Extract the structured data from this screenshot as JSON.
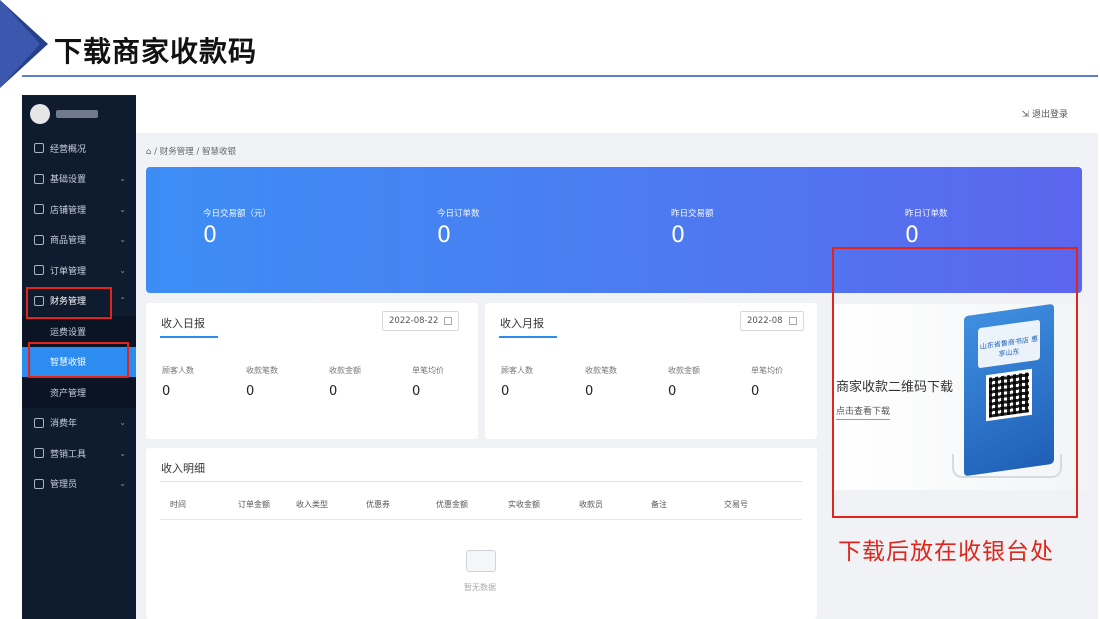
{
  "slide": {
    "title": "下载商家收款码"
  },
  "topbar": {
    "logout": "退出登录"
  },
  "breadcrumb": {
    "home_sep": "/",
    "level1": "财务管理",
    "sep": "/",
    "level2": "智慧收银"
  },
  "sidebar": {
    "items": [
      {
        "label": "经营概况",
        "chevron": ""
      },
      {
        "label": "基础设置",
        "chevron": "⌄"
      },
      {
        "label": "店铺管理",
        "chevron": "⌄"
      },
      {
        "label": "商品管理",
        "chevron": "⌄"
      },
      {
        "label": "订单管理",
        "chevron": "⌄"
      },
      {
        "label": "财务管理",
        "chevron": "⌃"
      }
    ],
    "subitems": [
      {
        "label": "运费设置"
      },
      {
        "label": "智慧收银"
      },
      {
        "label": "资产管理"
      }
    ],
    "items_after": [
      {
        "label": "消费年",
        "chevron": "⌄"
      },
      {
        "label": "营销工具",
        "chevron": "⌄"
      },
      {
        "label": "管理员",
        "chevron": "⌄"
      }
    ]
  },
  "banner": {
    "stats": [
      {
        "label": "今日交易额（元）",
        "value": "0"
      },
      {
        "label": "今日订单数",
        "value": "0"
      },
      {
        "label": "昨日交易额",
        "value": "0"
      },
      {
        "label": "昨日订单数",
        "value": "0"
      }
    ]
  },
  "daily": {
    "title": "收入日报",
    "date": "2022-08-22",
    "metrics": [
      {
        "label": "顾客人数",
        "value": "0"
      },
      {
        "label": "收款笔数",
        "value": "0"
      },
      {
        "label": "收款金额",
        "value": "0"
      },
      {
        "label": "单笔均价",
        "value": "0"
      }
    ]
  },
  "monthly": {
    "title": "收入月报",
    "date": "2022-08",
    "metrics": [
      {
        "label": "顾客人数",
        "value": "0"
      },
      {
        "label": "收款笔数",
        "value": "0"
      },
      {
        "label": "收款金额",
        "value": "0"
      },
      {
        "label": "单笔均价",
        "value": "0"
      }
    ]
  },
  "details": {
    "title": "收入明细",
    "columns": [
      "时间",
      "订单金额",
      "收入类型",
      "优惠券",
      "优惠金额",
      "实收金额",
      "收款员",
      "备注",
      "交易号"
    ],
    "empty": "暂无数据"
  },
  "promo": {
    "title": "商家收款二维码下载",
    "link": "点击查看下载",
    "stand_text": "山东省鲁商书店 惠享山东"
  },
  "caption": "下载后放在收银台处",
  "colors": {
    "accent": "#2d8cf0",
    "sidebar_bg": "#0f1c30",
    "highlight": "#e1251b"
  }
}
